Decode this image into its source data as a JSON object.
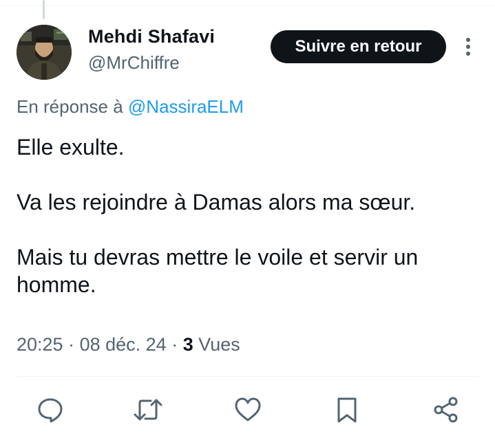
{
  "tweet": {
    "author": {
      "name": "Mehdi Shafavi",
      "handle": "@MrChiffre"
    },
    "follow_label": "Suivre en retour",
    "reply_to": {
      "prefix": "En réponse à",
      "mention": "@NassiraELM"
    },
    "text": [
      "Elle exulte.",
      "Va les rejoindre à Damas alors ma sœur.",
      "Mais tu devras mettre le voile et servir un homme."
    ],
    "meta": {
      "time": "20:25",
      "date": "08 déc. 24",
      "views_count": "3",
      "views_label": "Vues"
    }
  },
  "actions": [
    {
      "icon": "reply-icon"
    },
    {
      "icon": "retweet-icon"
    },
    {
      "icon": "like-icon"
    },
    {
      "icon": "bookmark-icon"
    },
    {
      "icon": "share-icon"
    }
  ],
  "colors": {
    "text": "#0f1419",
    "secondary": "#536471",
    "link": "#1d9bf0",
    "button_bg": "#0f1419",
    "divider": "#eff3f4"
  }
}
